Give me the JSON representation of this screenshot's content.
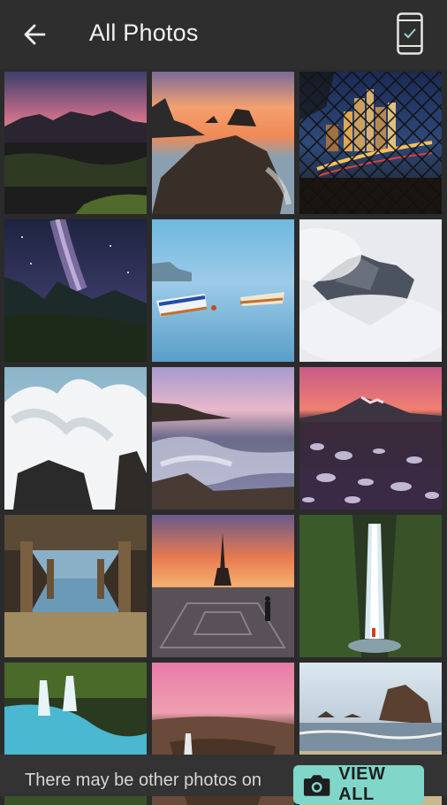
{
  "appbar": {
    "title": "All Photos",
    "back_icon": "arrow-left-icon",
    "device_icon": "phone-check-icon"
  },
  "photos": [
    {
      "subject": "volcanic mountains at sunset"
    },
    {
      "subject": "coastal sea stacks at sunset"
    },
    {
      "subject": "city skyline through chain-link fence at night"
    },
    {
      "subject": "milky way over mountains"
    },
    {
      "subject": "rowboats on calm lake"
    },
    {
      "subject": "mountain peak in clouds"
    },
    {
      "subject": "crashing wave on rocks"
    },
    {
      "subject": "long exposure rocky shore at dusk"
    },
    {
      "subject": "frozen lake with ice bubbles and mountain"
    },
    {
      "subject": "under the pier reflections"
    },
    {
      "subject": "eiffel tower at sunset"
    },
    {
      "subject": "waterfall in mossy canyon"
    },
    {
      "subject": "turquoise stream waterfall"
    },
    {
      "subject": "canyon at pink sunset"
    },
    {
      "subject": "beach with sea stacks"
    }
  ],
  "footer": {
    "hint": "There may be other photos on",
    "button_label": "VIEW ALL",
    "button_icon": "camera-icon",
    "accent": "#7fd6c9"
  }
}
